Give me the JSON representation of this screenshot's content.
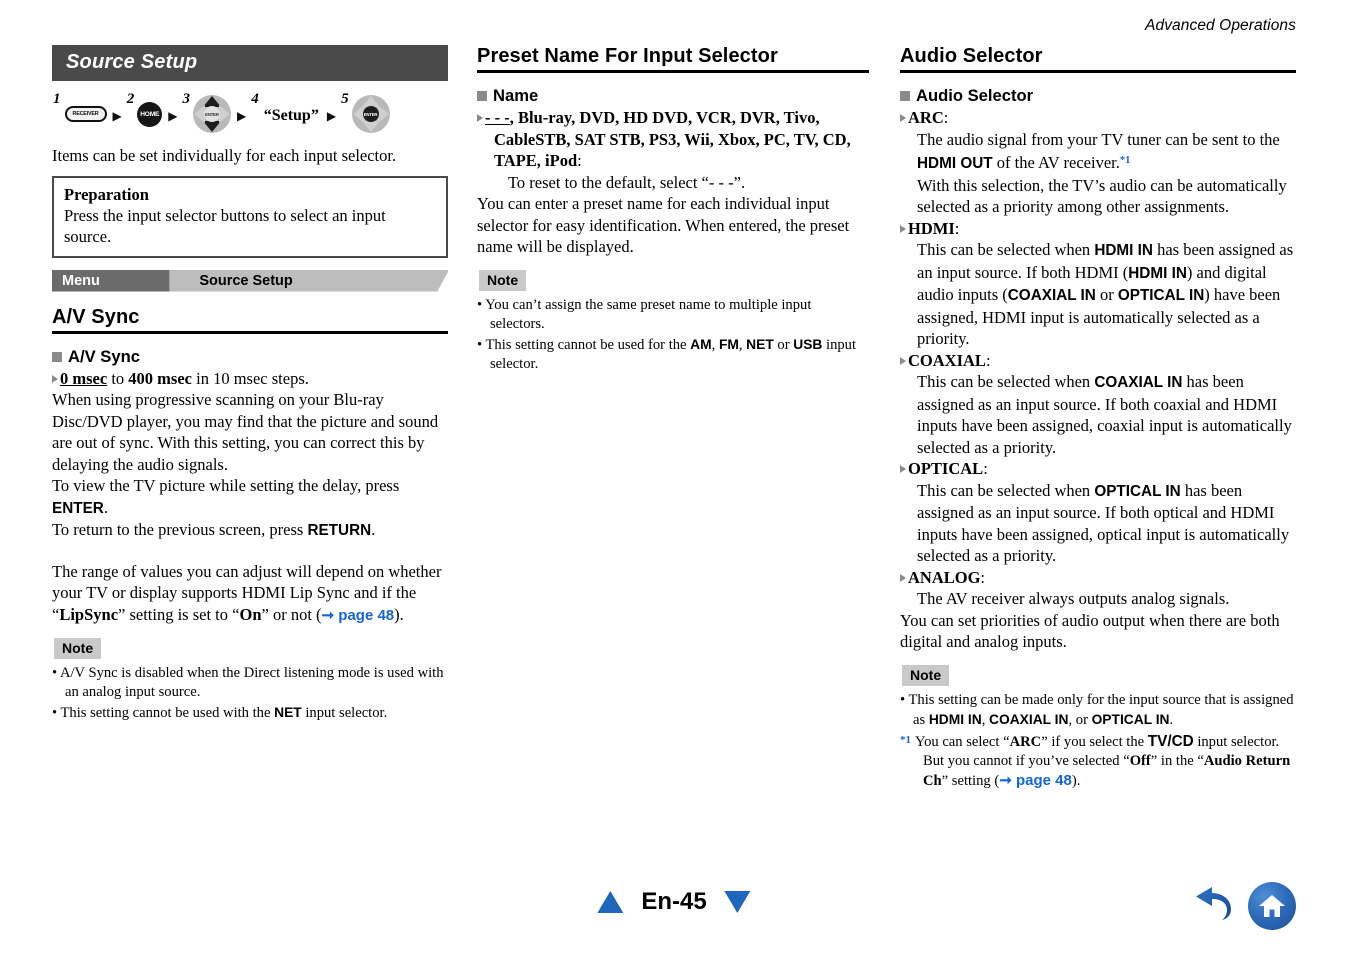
{
  "running_head": "Advanced Operations",
  "col1": {
    "banner_title": "Source Setup",
    "steps": [
      {
        "num": "1",
        "icon": "receiver-button-icon",
        "label": "RECEIVER"
      },
      {
        "num": "2",
        "icon": "home-button-icon",
        "label": "HOME"
      },
      {
        "num": "3",
        "icon": "dpad-updown-icon",
        "label": "ENTER"
      },
      {
        "num": "4",
        "icon": "quoted-text",
        "label": "“Setup”"
      },
      {
        "num": "5",
        "icon": "dpad-enter-icon",
        "label": "ENTER"
      }
    ],
    "intro": "Items can be set individually for each input selector.",
    "preparation": {
      "title": "Preparation",
      "text": "Press the input selector buttons to select an input source."
    },
    "breadcrumb": {
      "menu": "Menu",
      "current": "Source Setup"
    },
    "heading": "A/V Sync",
    "sub_heading": "A/V Sync",
    "range_default": "0 msec",
    "range_to": "to",
    "range_max": "400 msec",
    "range_tail": "in 10 msec steps.",
    "para1": "When using progressive scanning on your Blu-ray Disc/DVD player, you may find that the picture and sound are out of sync. With this setting, you can correct this by delaying the audio signals.",
    "para2_a": "To view the TV picture while setting the delay, press",
    "para2_b": "ENTER",
    "para2_c": ".",
    "para3_a": "To return to the previous screen, press",
    "para3_b": "RETURN",
    "para3_c": ".",
    "para4_a": "The range of values you can adjust will depend on whether your TV or display supports HDMI Lip Sync and if the “",
    "para4_lipsync": "LipSync",
    "para4_b": "” setting is set to “",
    "para4_on": "On",
    "para4_c": "” or not (",
    "para4_link": "page 48",
    "para4_d": ").",
    "note_label": "Note",
    "notes": [
      {
        "parts": [
          "A/V Sync is disabled when the Direct listening mode is used with an analog input source."
        ]
      },
      {
        "pre": "This setting cannot be used with the ",
        "bold": "NET",
        "post": " input selector."
      }
    ]
  },
  "col2": {
    "heading": "Preset Name For Input Selector",
    "sub_heading": "Name",
    "option_default": "- - -",
    "option_list": ", Blu-ray, DVD, HD DVD, VCR, DVR, Tivo, CableSTB, SAT STB, PS3, Wii, Xbox, PC, TV, CD, TAPE, iPod",
    "option_colon": ":",
    "option_detail": "To reset to the default, select “- - -”.",
    "para1": "You can enter a preset name for each individual input selector for easy identification. When entered, the preset name will be displayed.",
    "note_label": "Note",
    "notes": [
      {
        "text": "You can’t assign the same preset name to multiple input selectors."
      },
      {
        "pre": "This setting cannot be used for the ",
        "b1": "AM",
        "mid1": ", ",
        "b2": "FM",
        "mid2": ", ",
        "b3": "NET",
        "mid3": " or ",
        "b4": "USB",
        "post": " input selector."
      }
    ]
  },
  "col3": {
    "heading": "Audio Selector",
    "sub_heading": "Audio Selector",
    "options": [
      {
        "name": "ARC",
        "colon": ":",
        "body_a": "The audio signal from your TV tuner can be sent to the ",
        "body_bold": "HDMI OUT",
        "body_b": " of the AV receiver.",
        "footnote_mark": "*1",
        "body_c": "With this selection, the TV’s audio can be automatically selected as a priority among other assignments."
      },
      {
        "name": "HDMI",
        "colon": ":",
        "t1": "This can be selected when ",
        "b1": "HDMI IN",
        "t2": " has been assigned as an input source. If both HDMI (",
        "b2": "HDMI IN",
        "t3": ") and digital audio inputs (",
        "b3": "COAXIAL IN",
        "t4": " or ",
        "b4": "OPTICAL IN",
        "t5": ") have been assigned, HDMI input is automatically selected as a priority."
      },
      {
        "name": "COAXIAL",
        "colon": ":",
        "t1": "This can be selected when ",
        "b1": "COAXIAL IN",
        "t2": " has been assigned as an input source. If both coaxial and HDMI inputs have been assigned, coaxial input is automatically selected as a priority."
      },
      {
        "name": "OPTICAL",
        "colon": ":",
        "t1": "This can be selected when ",
        "b1": "OPTICAL IN",
        "t2": " has been assigned as an input source. If both optical and HDMI inputs have been assigned, optical input is automatically selected as a priority."
      },
      {
        "name": "ANALOG",
        "colon": ":",
        "t1": "The AV receiver always outputs analog signals."
      }
    ],
    "closing": "You can set priorities of audio output when there are both digital and analog inputs.",
    "note_label": "Note",
    "note1_pre": "This setting can be made only for the input source that is assigned as ",
    "note1_b1": "HDMI IN",
    "note1_m1": ", ",
    "note1_b2": "COAXIAL IN",
    "note1_m2": ", or ",
    "note1_b3": "OPTICAL IN",
    "note1_post": ".",
    "footnote_mark": "*1",
    "fn_t1": "You can select “",
    "fn_b1": "ARC",
    "fn_t2": "” if you select the ",
    "fn_b2": "TV/CD",
    "fn_t3": " input selector. But you cannot if you’ve selected “",
    "fn_b3": "Off",
    "fn_t4": "” in the “",
    "fn_b4": "Audio Return Ch",
    "fn_t5": "” setting (",
    "fn_link": "page 48",
    "fn_t6": ")."
  },
  "footer": {
    "prev_icon": "triangle-up-icon",
    "page_label": "En-45",
    "next_icon": "triangle-down-icon",
    "back_icon": "undo-arrow-icon",
    "home_icon": "home-icon"
  },
  "colors": {
    "banner_bg": "#4a4a4a",
    "crumb_dark": "#6b6b6b",
    "crumb_light": "#bdbdbd",
    "note_bg": "#c9c9c9",
    "link_blue": "#1565d8",
    "nav_blue": "#1f66bd"
  }
}
